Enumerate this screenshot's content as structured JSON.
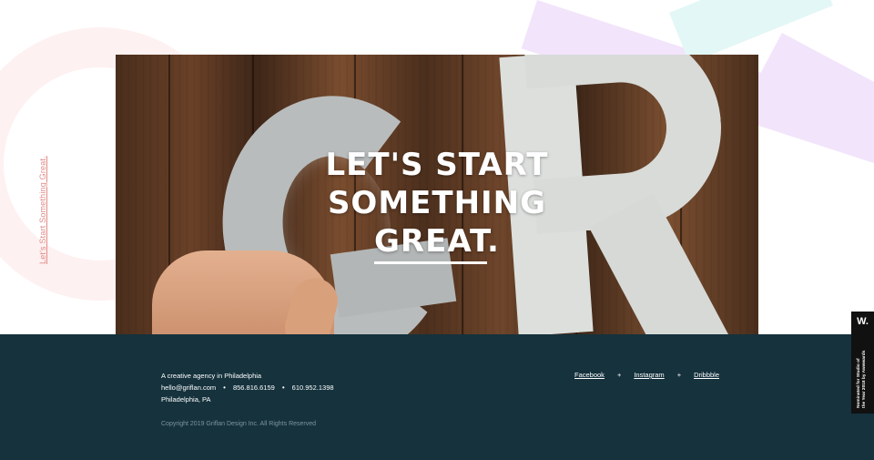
{
  "side_link": "Let's Start Something Great.",
  "hero": {
    "line1": "LET'S START",
    "line2": "SOMETHING",
    "line3_word": "GREAT",
    "line3_punct": "."
  },
  "footer": {
    "tagline": "A creative agency in Philadelphia",
    "email": "hello@griflan.com",
    "phone1": "856.816.6159",
    "phone2": "610.952.1398",
    "separator": "•",
    "location": "Philadelphia, PA",
    "copyright": "Copyright 2019 Griflan Design Inc. All Rights Reserved",
    "social": {
      "facebook": "Facebook",
      "instagram": "Instagram",
      "dribbble": "Dribbble",
      "plus": "+"
    }
  },
  "awwwards": {
    "logo": "W.",
    "line1": "Nominated for Studio of",
    "line2": "the Year 2018 by Awwwards"
  },
  "colors": {
    "footer_bg": "#15323d",
    "side_link": "#e28b86",
    "deco_pink": "#fdecec",
    "deco_purple": "#f2e4fb",
    "deco_teal": "#e3f7f6"
  }
}
